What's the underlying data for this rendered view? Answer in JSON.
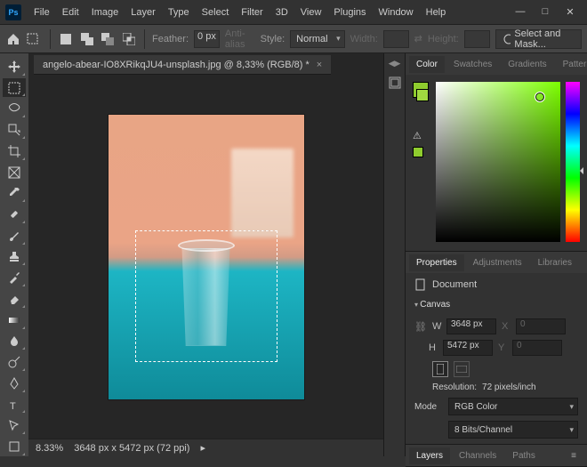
{
  "app": {
    "logo": "Ps"
  },
  "menu": [
    "File",
    "Edit",
    "Image",
    "Layer",
    "Type",
    "Select",
    "Filter",
    "3D",
    "View",
    "Plugins",
    "Window",
    "Help"
  ],
  "toolbar": {
    "feather_label": "Feather:",
    "feather_value": "0 px",
    "antialias": "Anti-alias",
    "style_label": "Style:",
    "style_value": "Normal",
    "width_label": "Width:",
    "height_label": "Height:",
    "mask_btn": "Select and Mask..."
  },
  "document": {
    "tab_title": "angelo-abear-IO8XRikqJU4-unsplash.jpg @ 8,33% (RGB/8) *"
  },
  "status": {
    "zoom": "8.33%",
    "dims": "3648 px x 5472 px (72 ppi)"
  },
  "color_panel": {
    "tabs": [
      "Color",
      "Swatches",
      "Gradients",
      "Patterns"
    ],
    "active": 0,
    "fg": "#8fcc2e",
    "bg": "#a0d840"
  },
  "properties": {
    "tabs": [
      "Properties",
      "Adjustments",
      "Libraries"
    ],
    "active": 0,
    "doc_label": "Document",
    "canvas_label": "Canvas",
    "w_label": "W",
    "w_value": "3648 px",
    "h_label": "H",
    "h_value": "5472 px",
    "x_label": "X",
    "x_value": "0",
    "y_label": "Y",
    "y_value": "0",
    "resolution_label": "Resolution:",
    "resolution_value": "72 pixels/inch",
    "mode_label": "Mode",
    "mode_value": "RGB Color",
    "depth_value": "8 Bits/Channel"
  },
  "layers_panel": {
    "tabs": [
      "Layers",
      "Channels",
      "Paths"
    ],
    "active": 0
  }
}
